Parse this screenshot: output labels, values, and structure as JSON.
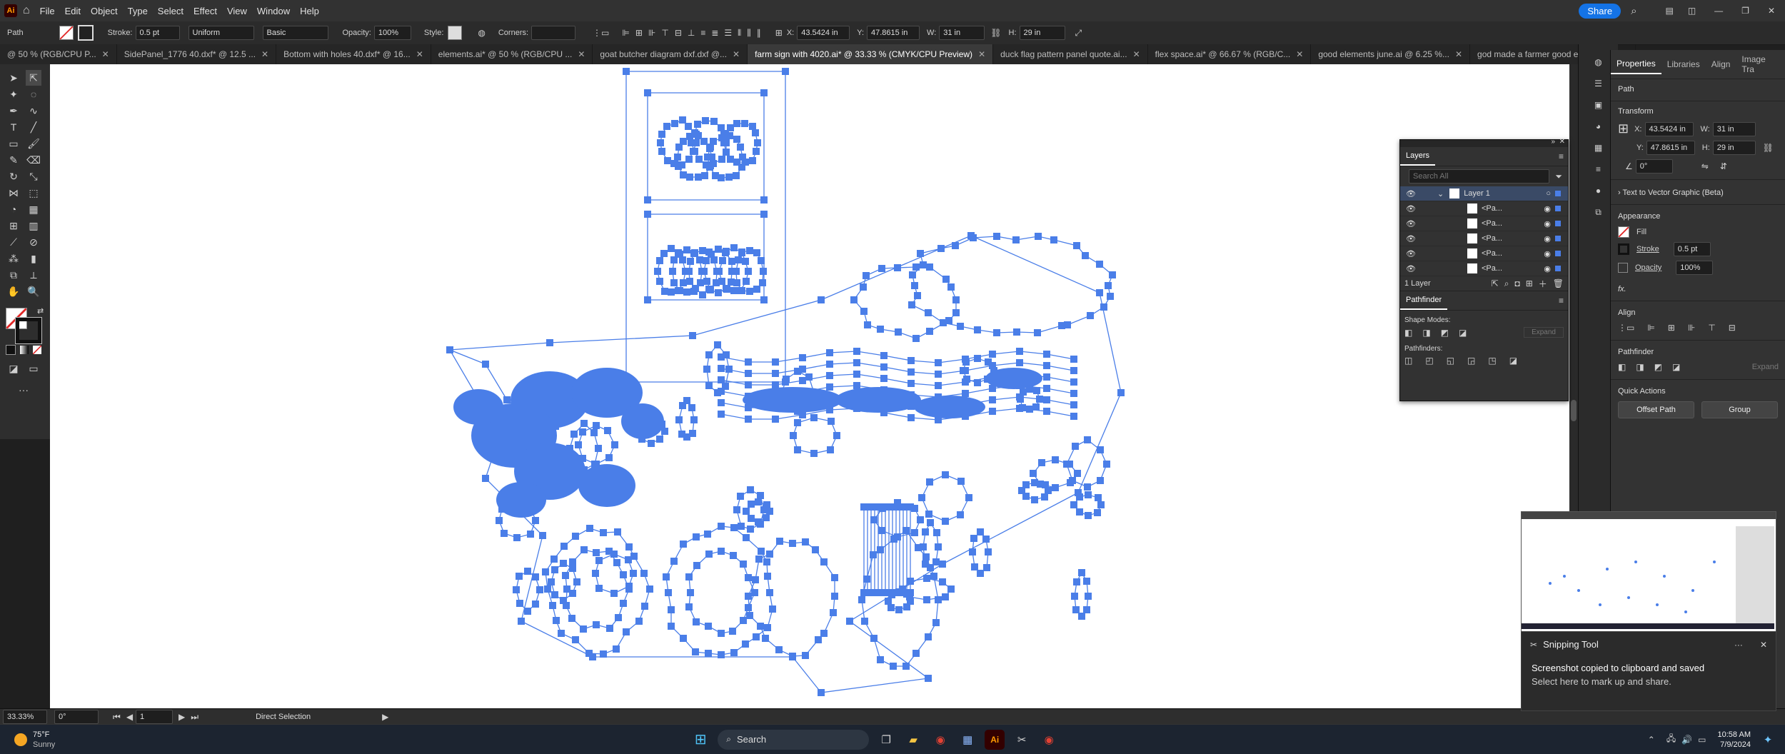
{
  "app": {
    "logo": "Ai",
    "name": "Adobe Illustrator"
  },
  "menu": [
    "File",
    "Edit",
    "Object",
    "Type",
    "Select",
    "Effect",
    "View",
    "Window",
    "Help"
  ],
  "topright": {
    "share": "Share"
  },
  "control": {
    "object_type": "Path",
    "stroke_label": "Stroke:",
    "stroke_value": "0.5 pt",
    "profile": "Uniform",
    "brush": "Basic",
    "opacity_label": "Opacity:",
    "opacity_value": "100%",
    "style_label": "Style:",
    "corners_label": "Corners:",
    "x_label": "X:",
    "x_value": "43.5424 in",
    "y_label": "Y:",
    "y_value": "47.8615 in",
    "w_label": "W:",
    "w_value": "31 in",
    "h_label": "H:",
    "h_value": "29 in"
  },
  "tabs": [
    {
      "label": "@ 50 % (RGB/CPU P...",
      "active": false
    },
    {
      "label": "SidePanel_1776 40.dxf* @ 12.5 ...",
      "active": false
    },
    {
      "label": "Bottom with holes 40.dxf* @ 16...",
      "active": false
    },
    {
      "label": "elements.ai* @ 50 % (RGB/CPU ...",
      "active": false
    },
    {
      "label": "goat butcher diagram dxf.dxf @...",
      "active": false
    },
    {
      "label": "farm sign with 4020.ai* @ 33.33 % (CMYK/CPU Preview)",
      "active": true
    },
    {
      "label": "duck flag pattern panel quote.ai...",
      "active": false
    },
    {
      "label": "flex space.ai* @ 66.67 % (RGB/C...",
      "active": false
    },
    {
      "label": "good elements june.ai @ 6.25 %...",
      "active": false
    },
    {
      "label": "god made a farmer good elements w ez",
      "active": false
    }
  ],
  "status": {
    "zoom": "33.33%",
    "rotation": "0°",
    "artboard": "1",
    "tool": "Direct Selection"
  },
  "properties": {
    "tabs": [
      "Properties",
      "Libraries",
      "Align",
      "Image Tra"
    ],
    "kind": "Path",
    "transform_title": "Transform",
    "x_label": "X:",
    "x": "43.5424 in",
    "y_label": "Y:",
    "y": "47.8615 in",
    "w_label": "W:",
    "w": "31 in",
    "h_label": "H:",
    "h": "29 in",
    "angle": "0°",
    "text_to_vector": "Text to Vector Graphic (Beta)",
    "appearance_title": "Appearance",
    "fill": "Fill",
    "stroke": "Stroke",
    "stroke_value": "0.5 pt",
    "opacity": "Opacity",
    "opacity_value": "100%",
    "fx": "fx.",
    "align_title": "Align",
    "pathfinder_title": "Pathfinder",
    "pf_expand": "Expand",
    "quick_actions_title": "Quick Actions",
    "offset_path": "Offset Path",
    "group": "Group"
  },
  "layers_panel": {
    "title": "Layers",
    "search_placeholder": "Search All",
    "layer_name": "Layer 1",
    "paths": [
      "<Pa...",
      "<Pa...",
      "<Pa...",
      "<Pa...",
      "<Pa..."
    ],
    "footer": "1 Layer"
  },
  "pathfinder_panel": {
    "title": "Pathfinder",
    "shape_modes": "Shape Modes:",
    "pathfinders": "Pathfinders:",
    "expand": "Expand"
  },
  "snip": {
    "app": "Snipping Tool",
    "more": "···",
    "title": "Screenshot copied to clipboard and saved",
    "body": "Select here to mark up and share."
  },
  "taskbar": {
    "temp": "75°F",
    "weather": "Sunny",
    "search": "Search",
    "time": "10:58 AM",
    "date": "7/9/2024"
  },
  "colors": {
    "selection": "#4a7ee8",
    "accent": "#1473e6"
  }
}
